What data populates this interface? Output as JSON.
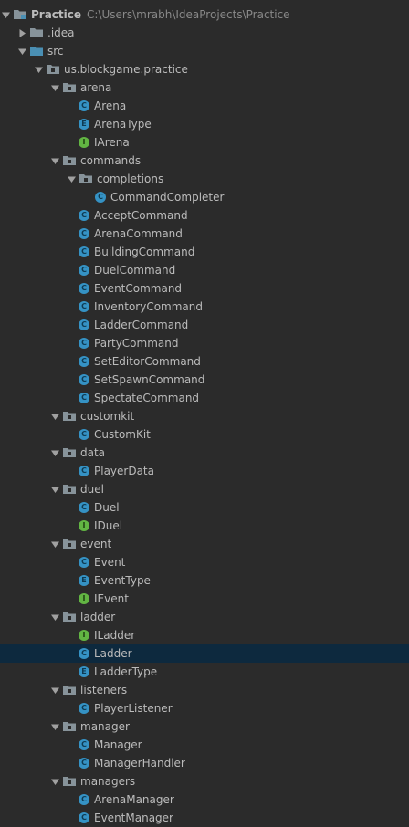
{
  "tree": {
    "nodes": [
      {
        "label": "Practice",
        "path": "C:\\Users\\mrabh\\IdeaProjects\\Practice",
        "kind": "module",
        "depth": 0,
        "expanded": true,
        "bold": true
      },
      {
        "label": ".idea",
        "kind": "folder",
        "depth": 1,
        "expanded": false
      },
      {
        "label": "src",
        "kind": "source-folder",
        "depth": 1,
        "expanded": true
      },
      {
        "label": "us.blockgame.practice",
        "kind": "package",
        "depth": 2,
        "expanded": true
      },
      {
        "label": "arena",
        "kind": "package",
        "depth": 3,
        "expanded": true
      },
      {
        "label": "Arena",
        "kind": "class",
        "depth": 4
      },
      {
        "label": "ArenaType",
        "kind": "enum",
        "depth": 4
      },
      {
        "label": "IArena",
        "kind": "interface",
        "depth": 4
      },
      {
        "label": "commands",
        "kind": "package",
        "depth": 3,
        "expanded": true
      },
      {
        "label": "completions",
        "kind": "package",
        "depth": 4,
        "expanded": true
      },
      {
        "label": "CommandCompleter",
        "kind": "class",
        "depth": 5
      },
      {
        "label": "AcceptCommand",
        "kind": "class",
        "depth": 4
      },
      {
        "label": "ArenaCommand",
        "kind": "class",
        "depth": 4
      },
      {
        "label": "BuildingCommand",
        "kind": "class",
        "depth": 4
      },
      {
        "label": "DuelCommand",
        "kind": "class",
        "depth": 4
      },
      {
        "label": "EventCommand",
        "kind": "class",
        "depth": 4
      },
      {
        "label": "InventoryCommand",
        "kind": "class",
        "depth": 4
      },
      {
        "label": "LadderCommand",
        "kind": "class",
        "depth": 4
      },
      {
        "label": "PartyCommand",
        "kind": "class",
        "depth": 4
      },
      {
        "label": "SetEditorCommand",
        "kind": "class",
        "depth": 4
      },
      {
        "label": "SetSpawnCommand",
        "kind": "class",
        "depth": 4
      },
      {
        "label": "SpectateCommand",
        "kind": "class",
        "depth": 4
      },
      {
        "label": "customkit",
        "kind": "package",
        "depth": 3,
        "expanded": true
      },
      {
        "label": "CustomKit",
        "kind": "class",
        "depth": 4
      },
      {
        "label": "data",
        "kind": "package",
        "depth": 3,
        "expanded": true
      },
      {
        "label": "PlayerData",
        "kind": "class",
        "depth": 4
      },
      {
        "label": "duel",
        "kind": "package",
        "depth": 3,
        "expanded": true
      },
      {
        "label": "Duel",
        "kind": "class",
        "depth": 4
      },
      {
        "label": "IDuel",
        "kind": "interface",
        "depth": 4
      },
      {
        "label": "event",
        "kind": "package",
        "depth": 3,
        "expanded": true
      },
      {
        "label": "Event",
        "kind": "class",
        "depth": 4
      },
      {
        "label": "EventType",
        "kind": "enum",
        "depth": 4
      },
      {
        "label": "IEvent",
        "kind": "interface",
        "depth": 4
      },
      {
        "label": "ladder",
        "kind": "package",
        "depth": 3,
        "expanded": true
      },
      {
        "label": "ILadder",
        "kind": "interface",
        "depth": 4
      },
      {
        "label": "Ladder",
        "kind": "class",
        "depth": 4,
        "selected": true
      },
      {
        "label": "LadderType",
        "kind": "enum",
        "depth": 4
      },
      {
        "label": "listeners",
        "kind": "package",
        "depth": 3,
        "expanded": true
      },
      {
        "label": "PlayerListener",
        "kind": "class",
        "depth": 4
      },
      {
        "label": "manager",
        "kind": "package",
        "depth": 3,
        "expanded": true
      },
      {
        "label": "Manager",
        "kind": "class",
        "depth": 4
      },
      {
        "label": "ManagerHandler",
        "kind": "class",
        "depth": 4
      },
      {
        "label": "managers",
        "kind": "package",
        "depth": 3,
        "expanded": true
      },
      {
        "label": "ArenaManager",
        "kind": "class",
        "depth": 4
      },
      {
        "label": "EventManager",
        "kind": "class",
        "depth": 4
      }
    ]
  },
  "icons": {
    "module": {
      "name": "module-folder-icon"
    },
    "folder": {
      "name": "folder-icon"
    },
    "source-folder": {
      "name": "source-folder-icon"
    },
    "package": {
      "name": "package-icon"
    },
    "class": {
      "name": "class-icon",
      "letter": "C"
    },
    "enum": {
      "name": "enum-icon",
      "letter": "E"
    },
    "interface": {
      "name": "interface-icon",
      "letter": "I"
    }
  },
  "colors": {
    "background": "#2b2b2b",
    "selection": "#0d293e",
    "text": "#bbbbbb",
    "path_text": "#888888",
    "class_icon": "#3592c4",
    "interface_icon": "#62b543",
    "folder": "#87939a",
    "source_folder": "#4a8fb3"
  }
}
